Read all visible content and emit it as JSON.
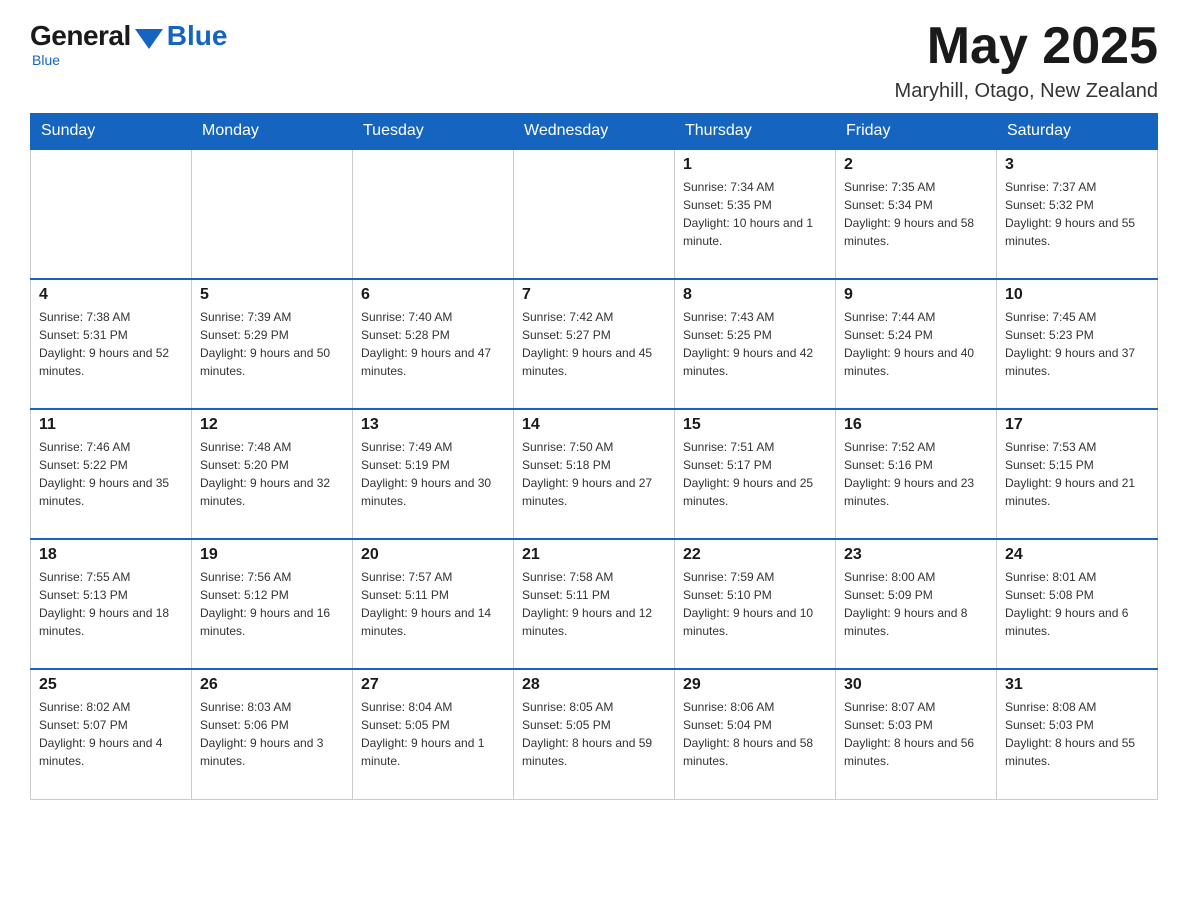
{
  "logo": {
    "general": "General",
    "blue": "Blue",
    "tagline": "Blue"
  },
  "header": {
    "month_title": "May 2025",
    "location": "Maryhill, Otago, New Zealand"
  },
  "days_of_week": [
    "Sunday",
    "Monday",
    "Tuesday",
    "Wednesday",
    "Thursday",
    "Friday",
    "Saturday"
  ],
  "weeks": [
    [
      {
        "day": "",
        "info": ""
      },
      {
        "day": "",
        "info": ""
      },
      {
        "day": "",
        "info": ""
      },
      {
        "day": "",
        "info": ""
      },
      {
        "day": "1",
        "info": "Sunrise: 7:34 AM\nSunset: 5:35 PM\nDaylight: 10 hours and 1 minute."
      },
      {
        "day": "2",
        "info": "Sunrise: 7:35 AM\nSunset: 5:34 PM\nDaylight: 9 hours and 58 minutes."
      },
      {
        "day": "3",
        "info": "Sunrise: 7:37 AM\nSunset: 5:32 PM\nDaylight: 9 hours and 55 minutes."
      }
    ],
    [
      {
        "day": "4",
        "info": "Sunrise: 7:38 AM\nSunset: 5:31 PM\nDaylight: 9 hours and 52 minutes."
      },
      {
        "day": "5",
        "info": "Sunrise: 7:39 AM\nSunset: 5:29 PM\nDaylight: 9 hours and 50 minutes."
      },
      {
        "day": "6",
        "info": "Sunrise: 7:40 AM\nSunset: 5:28 PM\nDaylight: 9 hours and 47 minutes."
      },
      {
        "day": "7",
        "info": "Sunrise: 7:42 AM\nSunset: 5:27 PM\nDaylight: 9 hours and 45 minutes."
      },
      {
        "day": "8",
        "info": "Sunrise: 7:43 AM\nSunset: 5:25 PM\nDaylight: 9 hours and 42 minutes."
      },
      {
        "day": "9",
        "info": "Sunrise: 7:44 AM\nSunset: 5:24 PM\nDaylight: 9 hours and 40 minutes."
      },
      {
        "day": "10",
        "info": "Sunrise: 7:45 AM\nSunset: 5:23 PM\nDaylight: 9 hours and 37 minutes."
      }
    ],
    [
      {
        "day": "11",
        "info": "Sunrise: 7:46 AM\nSunset: 5:22 PM\nDaylight: 9 hours and 35 minutes."
      },
      {
        "day": "12",
        "info": "Sunrise: 7:48 AM\nSunset: 5:20 PM\nDaylight: 9 hours and 32 minutes."
      },
      {
        "day": "13",
        "info": "Sunrise: 7:49 AM\nSunset: 5:19 PM\nDaylight: 9 hours and 30 minutes."
      },
      {
        "day": "14",
        "info": "Sunrise: 7:50 AM\nSunset: 5:18 PM\nDaylight: 9 hours and 27 minutes."
      },
      {
        "day": "15",
        "info": "Sunrise: 7:51 AM\nSunset: 5:17 PM\nDaylight: 9 hours and 25 minutes."
      },
      {
        "day": "16",
        "info": "Sunrise: 7:52 AM\nSunset: 5:16 PM\nDaylight: 9 hours and 23 minutes."
      },
      {
        "day": "17",
        "info": "Sunrise: 7:53 AM\nSunset: 5:15 PM\nDaylight: 9 hours and 21 minutes."
      }
    ],
    [
      {
        "day": "18",
        "info": "Sunrise: 7:55 AM\nSunset: 5:13 PM\nDaylight: 9 hours and 18 minutes."
      },
      {
        "day": "19",
        "info": "Sunrise: 7:56 AM\nSunset: 5:12 PM\nDaylight: 9 hours and 16 minutes."
      },
      {
        "day": "20",
        "info": "Sunrise: 7:57 AM\nSunset: 5:11 PM\nDaylight: 9 hours and 14 minutes."
      },
      {
        "day": "21",
        "info": "Sunrise: 7:58 AM\nSunset: 5:11 PM\nDaylight: 9 hours and 12 minutes."
      },
      {
        "day": "22",
        "info": "Sunrise: 7:59 AM\nSunset: 5:10 PM\nDaylight: 9 hours and 10 minutes."
      },
      {
        "day": "23",
        "info": "Sunrise: 8:00 AM\nSunset: 5:09 PM\nDaylight: 9 hours and 8 minutes."
      },
      {
        "day": "24",
        "info": "Sunrise: 8:01 AM\nSunset: 5:08 PM\nDaylight: 9 hours and 6 minutes."
      }
    ],
    [
      {
        "day": "25",
        "info": "Sunrise: 8:02 AM\nSunset: 5:07 PM\nDaylight: 9 hours and 4 minutes."
      },
      {
        "day": "26",
        "info": "Sunrise: 8:03 AM\nSunset: 5:06 PM\nDaylight: 9 hours and 3 minutes."
      },
      {
        "day": "27",
        "info": "Sunrise: 8:04 AM\nSunset: 5:05 PM\nDaylight: 9 hours and 1 minute."
      },
      {
        "day": "28",
        "info": "Sunrise: 8:05 AM\nSunset: 5:05 PM\nDaylight: 8 hours and 59 minutes."
      },
      {
        "day": "29",
        "info": "Sunrise: 8:06 AM\nSunset: 5:04 PM\nDaylight: 8 hours and 58 minutes."
      },
      {
        "day": "30",
        "info": "Sunrise: 8:07 AM\nSunset: 5:03 PM\nDaylight: 8 hours and 56 minutes."
      },
      {
        "day": "31",
        "info": "Sunrise: 8:08 AM\nSunset: 5:03 PM\nDaylight: 8 hours and 55 minutes."
      }
    ]
  ]
}
